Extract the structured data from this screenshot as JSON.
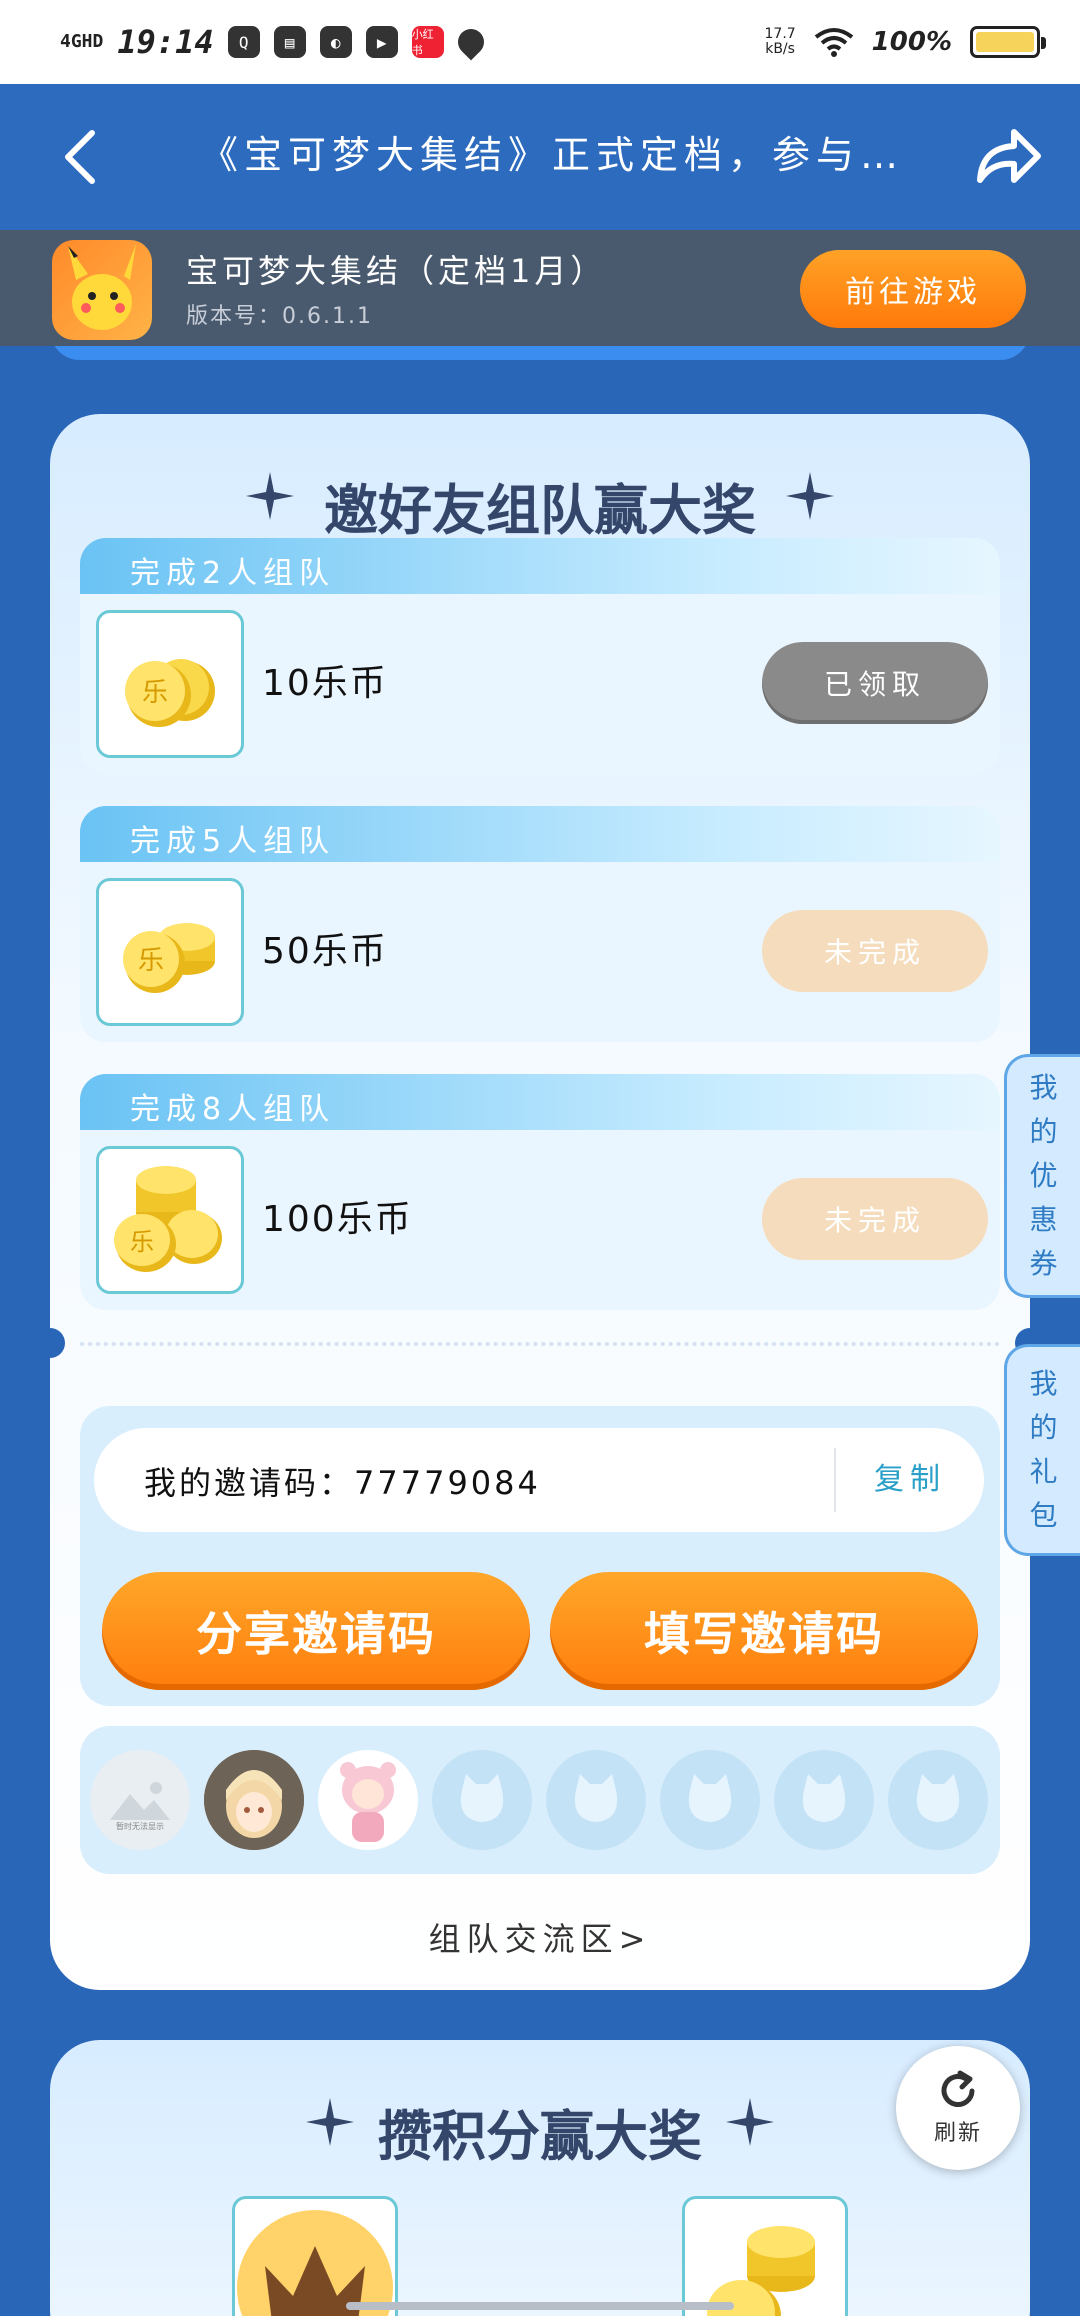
{
  "status_bar": {
    "network": "4GHD",
    "time": "19:14",
    "app_icons": [
      "qq-icon",
      "book-icon",
      "leaf-icon",
      "play-icon",
      "xiaohongshu-icon",
      "location-icon"
    ],
    "red_icon_text": "小红书",
    "net_speed_value": "17.7",
    "net_speed_unit": "kB/s",
    "battery_percent": "100%",
    "battery_level": 1.0,
    "battery_color": "#f6d35a"
  },
  "header": {
    "title": "《宝可梦大集结》正式定档，参与…"
  },
  "game": {
    "name": "宝可梦大集结（定档1月）",
    "version": "版本号：0.6.1.1",
    "button_label": "前往游戏"
  },
  "invite_card": {
    "title": "邀好友组队赢大奖",
    "tasks": [
      {
        "label": "完成2人组队",
        "reward": "10乐币",
        "status": "已领取"
      },
      {
        "label": "完成5人组队",
        "reward": "50乐币",
        "status": "未完成"
      },
      {
        "label": "完成8人组队",
        "reward": "100乐币",
        "status": "未完成"
      }
    ],
    "invite_code_label": "我的邀请码：77779084",
    "copy_label": "复制",
    "share_button": "分享邀请码",
    "fill_button": "填写邀请码",
    "placeholder_avatar_caption": "暂时无法显示",
    "team_link": "组队交流区>"
  },
  "points_card": {
    "title": "攒积分赢大奖"
  },
  "side_tabs": {
    "coupons": [
      "我",
      "的",
      "优",
      "惠",
      "券"
    ],
    "gifts": [
      "我",
      "的",
      "礼",
      "包"
    ]
  },
  "refresh_label": "刷新",
  "colors": {
    "header_blue": "#2d6bbf",
    "accent_orange": "#ff7d0c",
    "claimed_gray": "#8a8a8a",
    "pending_peach": "#f5dcbd"
  }
}
